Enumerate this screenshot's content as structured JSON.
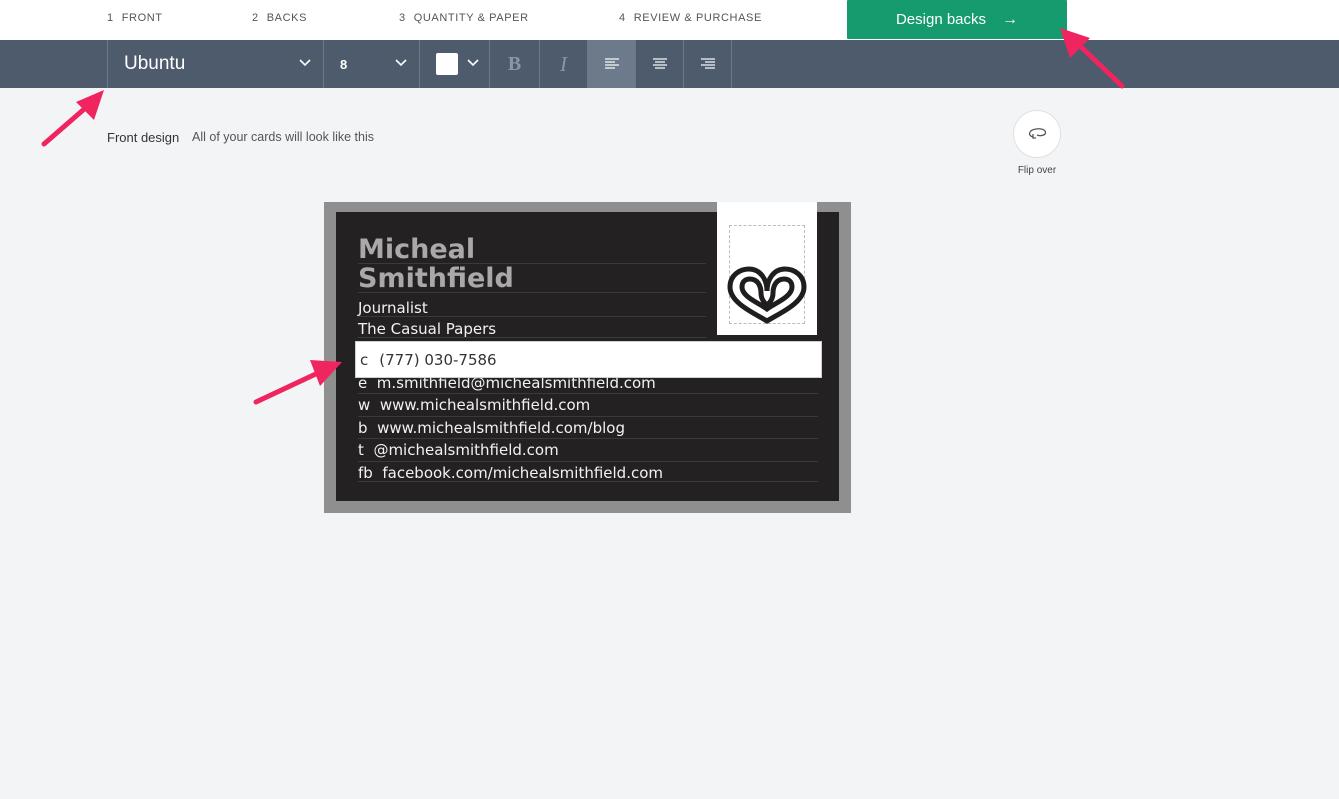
{
  "steps": [
    {
      "num": "1",
      "label": "FRONT"
    },
    {
      "num": "2",
      "label": "BACKS"
    },
    {
      "num": "3",
      "label": "QUANTITY & PAPER"
    },
    {
      "num": "4",
      "label": "REVIEW & PURCHASE"
    }
  ],
  "cta": {
    "label": "Design backs",
    "arrow": "→",
    "color": "#169b6f"
  },
  "toolbar": {
    "font": "Ubuntu",
    "size": "8",
    "color_value": "#ffffff",
    "bold_glyph": "B",
    "italic_glyph": "I",
    "active_align": "left"
  },
  "page": {
    "front_title": "Front design",
    "front_subtitle": "All of your cards will look like this",
    "flip_label": "Flip over"
  },
  "card": {
    "name_line1": "Micheal",
    "name_line2": "Smithfield",
    "title": "Journalist",
    "company": "The Casual Papers",
    "phone_prefix": "c",
    "phone": "(777) 030-7586",
    "contacts": [
      {
        "prefix": "e",
        "value": "m.smithfield@michealsmithfield.com"
      },
      {
        "prefix": "w",
        "value": "www.michealsmithfield.com"
      },
      {
        "prefix": "b",
        "value": "www.michealsmithfield.com/blog"
      },
      {
        "prefix": "t",
        "value": "@michealsmithfield.com"
      },
      {
        "prefix": "fb",
        "value": "facebook.com/michealsmithfield.com"
      }
    ]
  },
  "annotation_color": "#f0245f"
}
